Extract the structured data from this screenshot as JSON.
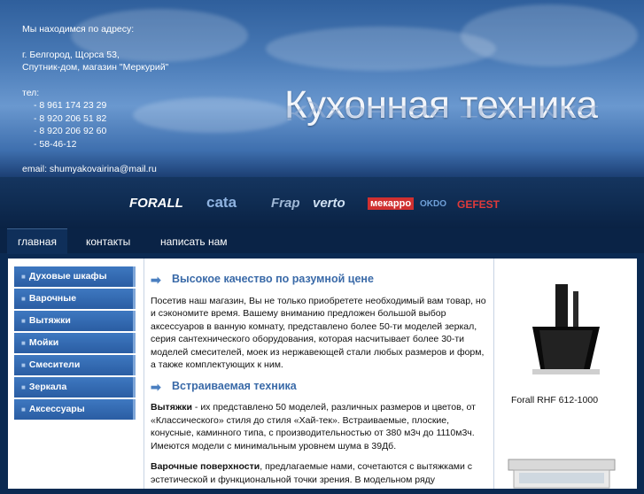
{
  "contacts": {
    "line1": "Мы находимся по адресу:",
    "line2": "г. Белгород, Щорса 53,",
    "line3": "Спутник-дом, магазин \"Меркурий\"",
    "tel_label": "тел:",
    "phones": [
      "- 8 961 174 23 29",
      "- 8 920 206 51 82",
      "- 8 920 206 92 60",
      "- 58-46-12"
    ],
    "email": "email: shumyakovairina@mail.ru"
  },
  "site_title": "Кухонная техника",
  "brands": [
    "FORALL",
    "cata",
    "Frap",
    "verto",
    "мекарро",
    "OKDO",
    "GEFEST"
  ],
  "nav": [
    "главная",
    "контакты",
    "написать нам"
  ],
  "sidebar": [
    "Духовые шкафы",
    "Варочные поверхности",
    "Вытяжки",
    "Мойки",
    "Смесители",
    "Зеркала",
    "Аксессуары"
  ],
  "main": {
    "heading1": "Высокое качество по разумной цене",
    "para1": "Посетив наш магазин, Вы не только приобретете необходимый вам товар, но и сэкономите время. Вашему вниманию предложен большой выбор аксессуаров в ванную комнату, представлено более 50-ти моделей зеркал, серия сантехнического оборудования, которая насчитывает более 30-ти моделей смесителей, моек из нержавеющей стали любых размеров и форм, а также комплектующих к ним.",
    "heading2": "Встраиваемая техника",
    "para2_bold": "Вытяжки",
    "para2": " - их представлено 50 моделей, различных размеров и цветов, от «Классического» стиля до стиля «Хай-тек». Встраиваемые, плоские, конусные, каминного типа, с производительностью от 380 м3ч до 1110м3ч. Имеются модели с минимальным уровнем шума в 39Дб.",
    "para3_bold": "Варочные поверхности",
    "para3": ", предлагаемые нами, сочетаются с вытяжками с эстетической и функциональной точки зрения. В модельном ряду"
  },
  "product": {
    "caption": "Forall RHF 612-1000"
  }
}
